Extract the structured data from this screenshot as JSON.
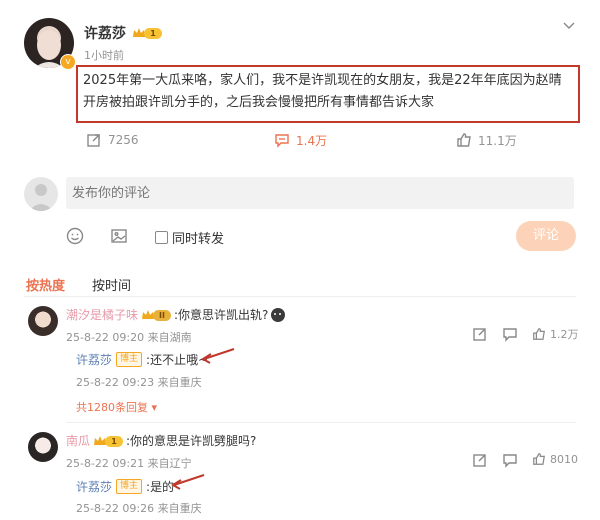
{
  "post": {
    "author": "许荔莎",
    "level_badge": "1",
    "time": "1小时前",
    "body": "2025年第一大瓜来咯，家人们，我不是许凯现在的女朋友，我是22年年底因为赵晴开房被拍跟许凯分手的，之后我会慢慢把所有事情都告诉大家",
    "stats": {
      "repost": "7256",
      "comment": "1.4万",
      "like": "11.1万"
    }
  },
  "composer": {
    "placeholder": "发布你的评论",
    "also_repost": "同时转发",
    "submit": "评论"
  },
  "sort_tabs": [
    "按热度",
    "按时间"
  ],
  "comments": [
    {
      "name": "潮汐是橘子味",
      "level_badge": "II",
      "text": ":你意思许凯出轨?",
      "meta": "25-8-22 09:20 来自湖南",
      "likes": "1.2万",
      "reply": {
        "name": "许荔莎",
        "tag": "博主",
        "text": ":还不止哦~",
        "meta": "25-8-22 09:23 来自重庆"
      },
      "more_replies": "共1280条回复"
    },
    {
      "name": "南瓜",
      "level_badge": "1",
      "text": ":你的意思是许凯劈腿吗?",
      "meta": "25-8-22 09:21 来自辽宁",
      "likes": "8010",
      "reply": {
        "name": "许荔莎",
        "tag": "博主",
        "text": ":是的",
        "meta": "25-8-22 09:26 来自重庆"
      }
    }
  ],
  "colors": {
    "accent": "#eb7350",
    "link_blue": "#5d7fb3",
    "annotation_red": "#c0392b",
    "submit_bg": "#fcd3b8"
  },
  "icons": [
    "chevron-down-icon",
    "repost-icon",
    "comment-icon",
    "like-icon",
    "emoji-icon",
    "image-icon",
    "checkbox-icon",
    "share-icon",
    "v-verified-icon"
  ]
}
